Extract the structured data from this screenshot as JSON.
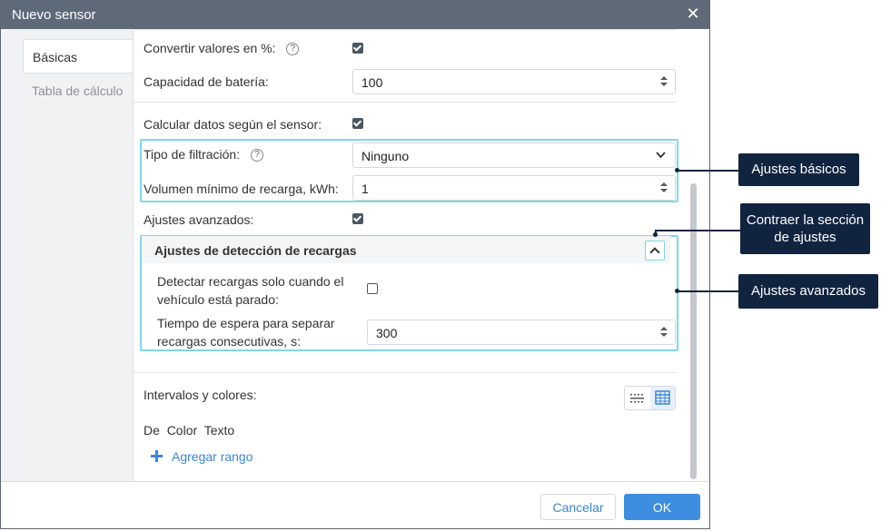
{
  "dialog": {
    "title": "Nuevo sensor",
    "close_label": "✕"
  },
  "sidebar": {
    "tabs": [
      {
        "label": "Básicas",
        "active": true
      },
      {
        "label": "Tabla de cálculo",
        "active": false
      }
    ]
  },
  "form": {
    "convert_percent_label": "Convertir valores en %:",
    "convert_percent_checked": true,
    "battery_label": "Capacidad de batería:",
    "battery_value": "100",
    "calc_by_sensor_label": "Calcular datos según el sensor:",
    "calc_by_sensor_checked": true,
    "filter_type_label": "Tipo de filtración:",
    "filter_type_value": "Ninguno",
    "min_refill_label": "Volumen mínimo de recarga, kWh:",
    "min_refill_value": "1",
    "advanced_label": "Ajustes avanzados:",
    "advanced_checked": true,
    "refill_section_title": "Ajustes de detección de recargas",
    "detect_stopped_label_line1": "Detectar recargas solo cuando el",
    "detect_stopped_label_line2": "vehículo está parado:",
    "detect_stopped_checked": false,
    "wait_time_label_line1": "Tiempo de espera para separar",
    "wait_time_label_line2": "recargas consecutivas, s:",
    "wait_time_value": "300",
    "intervals_label": "Intervalos y colores:",
    "intervals_columns": [
      "De",
      "Color",
      "Texto"
    ],
    "add_range_label": "Agregar rango"
  },
  "footer": {
    "cancel_label": "Cancelar",
    "ok_label": "OK"
  },
  "callouts": {
    "basic": "Ajustes básicos",
    "collapse_line1": "Contraer la sección",
    "collapse_line2": "de ajustes",
    "advanced": "Ajustes avanzados"
  },
  "colors": {
    "titlebar": "#5e6a78",
    "accent": "#3d8ee0",
    "highlight": "#7fd8e6",
    "callout_bg": "#102440"
  }
}
